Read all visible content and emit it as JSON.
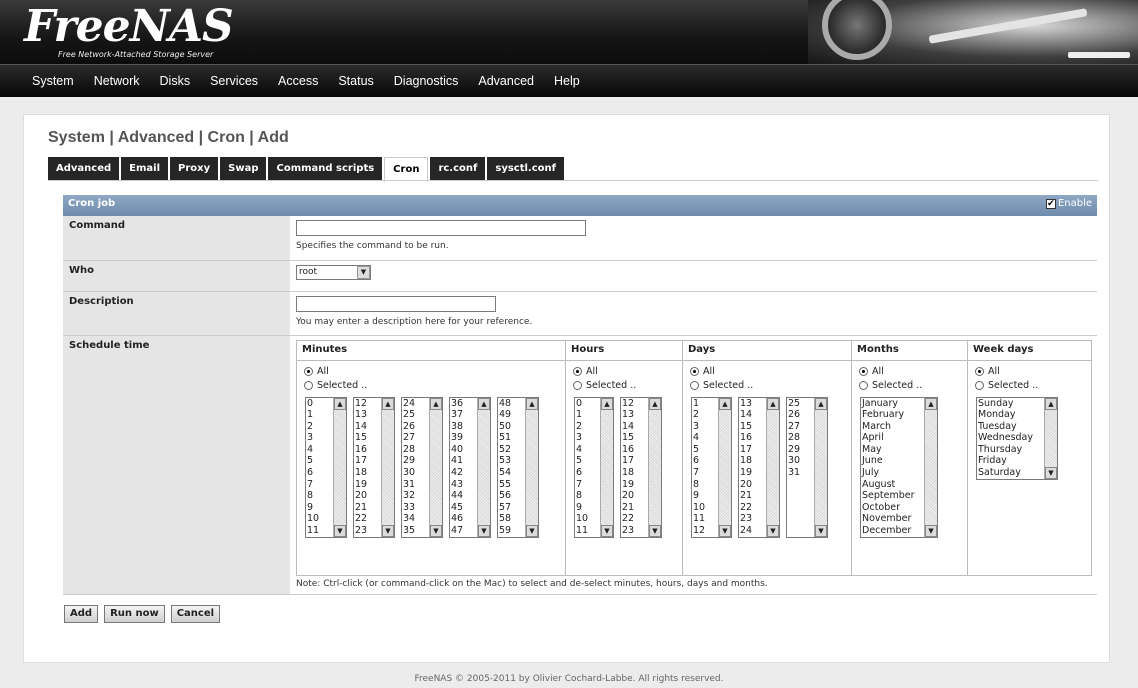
{
  "header": {
    "logo": "FreeNAS",
    "tagline": "Free Network-Attached Storage Server"
  },
  "menu": [
    "System",
    "Network",
    "Disks",
    "Services",
    "Access",
    "Status",
    "Diagnostics",
    "Advanced",
    "Help"
  ],
  "page": {
    "title": "System | Advanced | Cron | Add"
  },
  "tabs": [
    "Advanced",
    "Email",
    "Proxy",
    "Swap",
    "Command scripts",
    "Cron",
    "rc.conf",
    "sysctl.conf"
  ],
  "active_tab": "Cron",
  "form": {
    "section_title": "Cron job",
    "enable_label": "Enable",
    "enable_checked": true,
    "command": {
      "label": "Command",
      "value": "",
      "hint": "Specifies the command to be run."
    },
    "who": {
      "label": "Who",
      "value": "root"
    },
    "description": {
      "label": "Description",
      "value": "",
      "hint": "You may enter a description here for your reference."
    },
    "schedule": {
      "label": "Schedule time",
      "all_label": "All",
      "selected_label": "Selected ..",
      "columns": [
        {
          "title": "Minutes",
          "lists": [
            [
              "0",
              "1",
              "2",
              "3",
              "4",
              "5",
              "6",
              "7",
              "8",
              "9",
              "10",
              "11"
            ],
            [
              "12",
              "13",
              "14",
              "15",
              "16",
              "17",
              "18",
              "19",
              "20",
              "21",
              "22",
              "23"
            ],
            [
              "24",
              "25",
              "26",
              "27",
              "28",
              "29",
              "30",
              "31",
              "32",
              "33",
              "34",
              "35"
            ],
            [
              "36",
              "37",
              "38",
              "39",
              "40",
              "41",
              "42",
              "43",
              "44",
              "45",
              "46",
              "47"
            ],
            [
              "48",
              "49",
              "50",
              "51",
              "52",
              "53",
              "54",
              "55",
              "56",
              "57",
              "58",
              "59"
            ]
          ]
        },
        {
          "title": "Hours",
          "lists": [
            [
              "0",
              "1",
              "2",
              "3",
              "4",
              "5",
              "6",
              "7",
              "8",
              "9",
              "10",
              "11"
            ],
            [
              "12",
              "13",
              "14",
              "15",
              "16",
              "17",
              "18",
              "19",
              "20",
              "21",
              "22",
              "23"
            ]
          ]
        },
        {
          "title": "Days",
          "lists": [
            [
              "1",
              "2",
              "3",
              "4",
              "5",
              "6",
              "7",
              "8",
              "9",
              "10",
              "11",
              "12"
            ],
            [
              "13",
              "14",
              "15",
              "16",
              "17",
              "18",
              "19",
              "20",
              "21",
              "22",
              "23",
              "24"
            ],
            [
              "25",
              "26",
              "27",
              "28",
              "29",
              "30",
              "31"
            ]
          ]
        },
        {
          "title": "Months",
          "lists": [
            [
              "January",
              "February",
              "March",
              "April",
              "May",
              "June",
              "July",
              "August",
              "September",
              "October",
              "November",
              "December"
            ]
          ]
        },
        {
          "title": "Week days",
          "lists": [
            [
              "Sunday",
              "Monday",
              "Tuesday",
              "Wednesday",
              "Thursday",
              "Friday",
              "Saturday"
            ]
          ]
        }
      ],
      "note": "Note: Ctrl-click (or command-click on the Mac) to select and de-select minutes, hours, days and months."
    }
  },
  "buttons": {
    "add": "Add",
    "run_now": "Run now",
    "cancel": "Cancel"
  },
  "footer": "FreeNAS © 2005-2011 by Olivier Cochard-Labbe. All rights reserved."
}
